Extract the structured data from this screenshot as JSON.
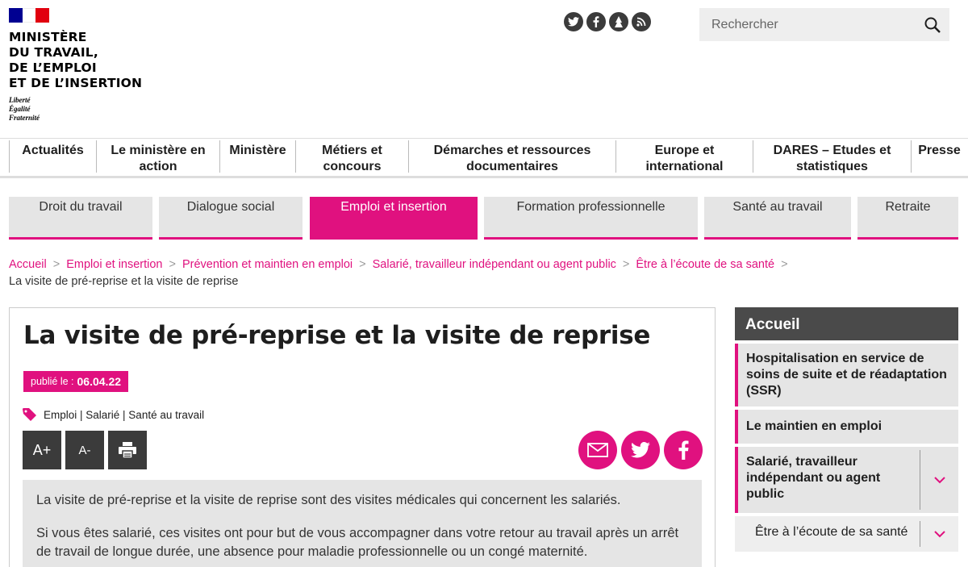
{
  "header": {
    "logo_lines": [
      "MINISTÈRE",
      "DU TRAVAIL,",
      "DE L’EMPLOI",
      "ET DE L’INSERTION"
    ],
    "motto": [
      "Liberté",
      "Égalité",
      "Fraternité"
    ],
    "flag_colors": [
      "#000091",
      "#ffffff",
      "#e1000f"
    ],
    "social": [
      "twitter-icon",
      "facebook-icon",
      "flickr-icon",
      "rss-icon"
    ],
    "search": {
      "placeholder": "Rechercher"
    }
  },
  "mainnav": [
    "Actualités",
    "Le ministère en action",
    "Ministère",
    "Métiers et concours",
    "Démarches et ressources documentaires",
    "Europe et international",
    "DARES – Etudes et statistiques",
    "Presse"
  ],
  "tabs": [
    {
      "label": "Droit du travail",
      "active": false
    },
    {
      "label": "Dialogue social",
      "active": false
    },
    {
      "label": "Emploi et insertion",
      "active": true
    },
    {
      "label": "Formation professionnelle",
      "active": false
    },
    {
      "label": "Santé au travail",
      "active": false
    },
    {
      "label": "Retraite",
      "active": false
    }
  ],
  "breadcrumb": {
    "links": [
      "Accueil",
      "Emploi et insertion",
      "Prévention et maintien en emploi",
      "Salarié, travailleur indépendant ou agent public",
      "Être à l’écoute de sa santé"
    ],
    "current": "La visite de pré-reprise et la visite de reprise"
  },
  "article": {
    "title": "La visite de pré-reprise et la visite de reprise",
    "published_label": "publié le :",
    "published_date": "06.04.22",
    "tags": "Emploi | Salarié | Santé au travail",
    "tools": {
      "increase": "A+",
      "decrease": "A-"
    },
    "intro": [
      "La visite de pré-reprise et la visite de reprise sont des visites médicales qui concernent les salariés.",
      "Si vous êtes salarié, ces visites ont pour but de vous accompagner dans votre retour au travail après un arrêt de travail de longue durée, une absence pour maladie professionnelle ou un congé maternité."
    ]
  },
  "sidebar": {
    "head": "Accueil",
    "items": [
      "Hospitalisation en service de soins de suite et de réadaptation (SSR)",
      "Le maintien en emploi",
      "Salarié, travailleur indépendant ou agent public"
    ],
    "sub": "Être à l’écoute de sa santé"
  },
  "colors": {
    "accent": "#e0117f",
    "dark": "#3b3b3b",
    "grey": "#e5e5e5"
  }
}
